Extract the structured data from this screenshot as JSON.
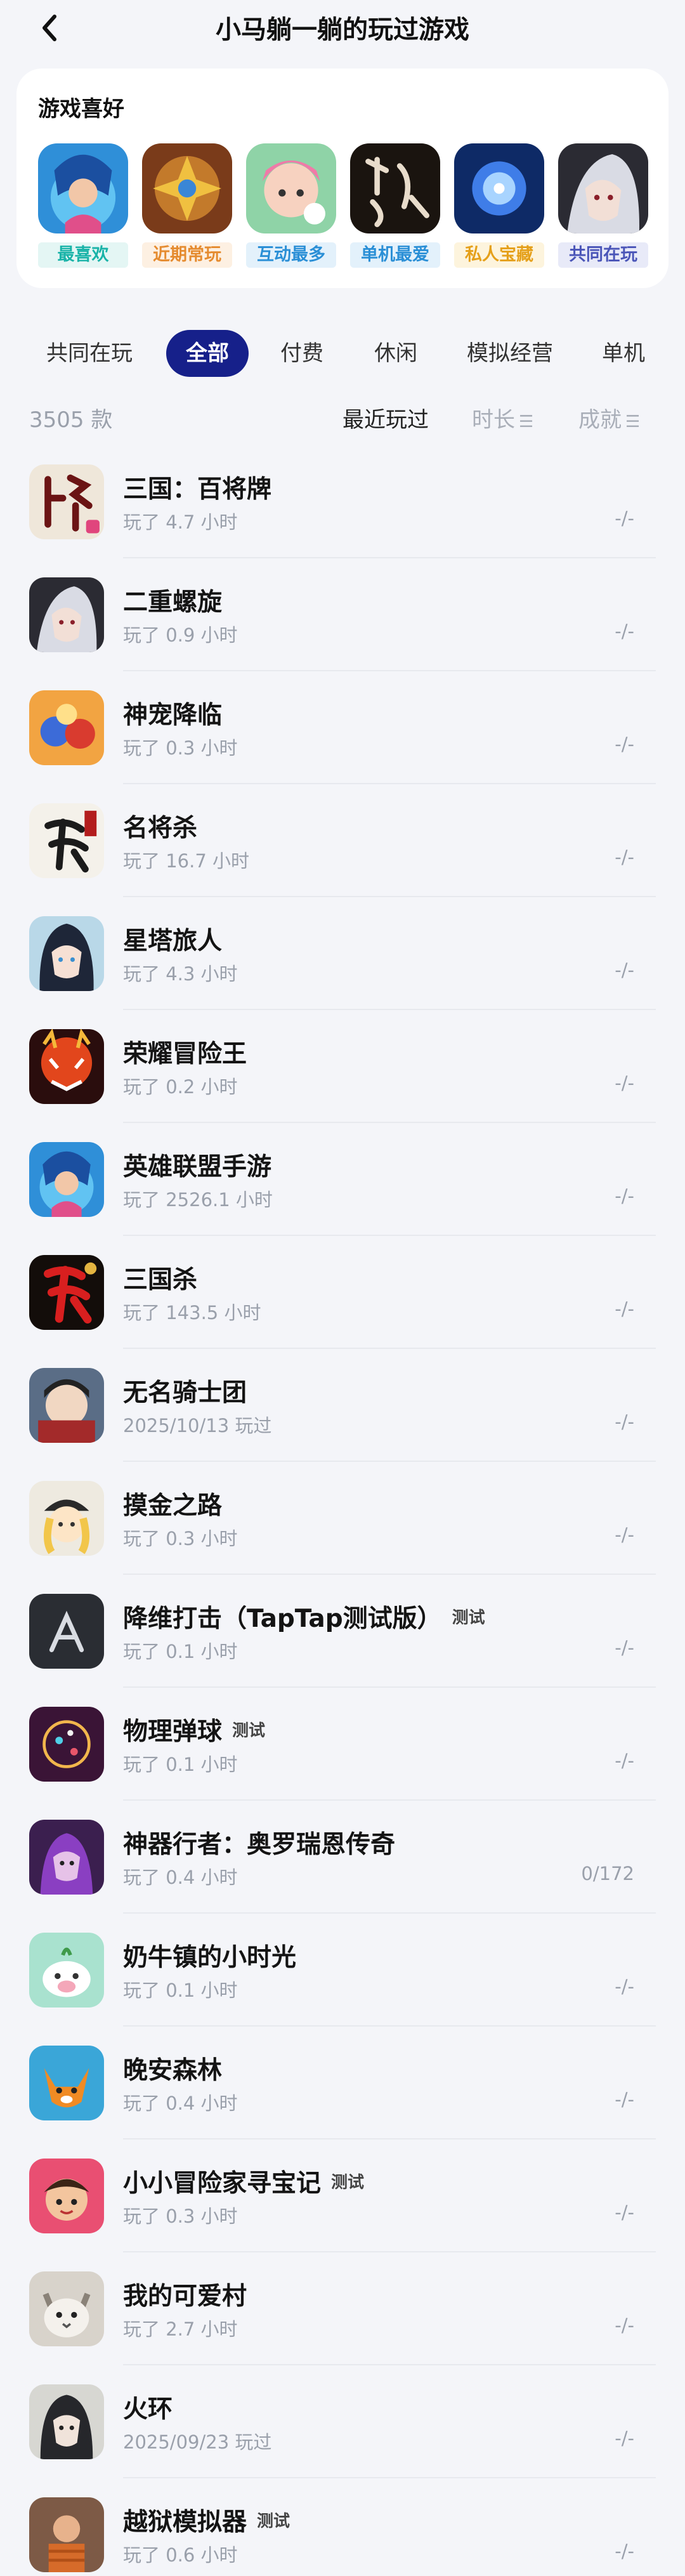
{
  "header": {
    "title": "小马躺一躺的玩过游戏"
  },
  "favorites": {
    "title": "游戏喜好",
    "items": [
      {
        "label": "最喜欢",
        "color": "#19b3a8",
        "bg": "#e4f6f4",
        "icon": "hero-lol-icon"
      },
      {
        "label": "近期常玩",
        "color": "#e58b2f",
        "bg": "#fdf0e2",
        "icon": "hearthstone-icon"
      },
      {
        "label": "互动最多",
        "color": "#2a8fd6",
        "bg": "#e3f1fb",
        "icon": "cute-girl-icon"
      },
      {
        "label": "单机最爱",
        "color": "#2a8fd6",
        "bg": "#e3f1fb",
        "icon": "jianghu-calligraphy-icon"
      },
      {
        "label": "私人宝藏",
        "color": "#e5a01a",
        "bg": "#fdf4dd",
        "icon": "crystal-ball-icon"
      },
      {
        "label": "共同在玩",
        "color": "#4a55b8",
        "bg": "#e8eaf8",
        "icon": "silver-hair-character-icon"
      }
    ]
  },
  "tabs": [
    {
      "label": "共同在玩",
      "active": false
    },
    {
      "label": "全部",
      "active": true
    },
    {
      "label": "付费",
      "active": false
    },
    {
      "label": "休闲",
      "active": false
    },
    {
      "label": "模拟经营",
      "active": false
    },
    {
      "label": "单机",
      "active": false
    }
  ],
  "sort": {
    "count": "3505 款",
    "options": [
      {
        "label": "最近玩过",
        "active": true
      },
      {
        "label": "时长",
        "active": false
      },
      {
        "label": "成就",
        "active": false
      }
    ]
  },
  "games": [
    {
      "name": "三国：百将牌",
      "sub": "玩了 4.7 小时",
      "ach": "-/-",
      "badge": "",
      "icon": "pai-card-icon"
    },
    {
      "name": "二重螺旋",
      "sub": "玩了 0.9 小时",
      "ach": "-/-",
      "badge": "",
      "icon": "silver-hair-character-icon"
    },
    {
      "name": "神宠降临",
      "sub": "玩了 0.3 小时",
      "ach": "-/-",
      "badge": "",
      "icon": "pet-squad-icon"
    },
    {
      "name": "名将杀",
      "sub": "玩了 16.7 小时",
      "ach": "-/-",
      "badge": "",
      "icon": "sha-calligraphy-icon"
    },
    {
      "name": "星塔旅人",
      "sub": "玩了 4.3 小时",
      "ach": "-/-",
      "badge": "",
      "icon": "anime-girl-icon"
    },
    {
      "name": "荣耀冒险王",
      "sub": "玩了 0.2 小时",
      "ach": "-/-",
      "badge": "",
      "icon": "demon-king-icon"
    },
    {
      "name": "英雄联盟手游",
      "sub": "玩了 2526.1 小时",
      "ach": "-/-",
      "badge": "",
      "icon": "hero-lol-icon"
    },
    {
      "name": "三国杀",
      "sub": "玩了 143.5 小时",
      "ach": "-/-",
      "badge": "",
      "icon": "sanguosha-icon"
    },
    {
      "name": "无名骑士团",
      "sub": "2025/10/13 玩过",
      "ach": "-/-",
      "badge": "",
      "icon": "knight-squad-icon"
    },
    {
      "name": "摸金之路",
      "sub": "玩了 0.3 小时",
      "ach": "-/-",
      "badge": "",
      "icon": "explorer-girl-icon"
    },
    {
      "name": "降维打击（TapTap测试版）",
      "sub": "玩了 0.1 小时",
      "ach": "-/-",
      "badge": "测试",
      "icon": "dark-logo-icon"
    },
    {
      "name": "物理弹球",
      "sub": "玩了 0.1 小时",
      "ach": "-/-",
      "badge": "测试",
      "icon": "pinball-icon"
    },
    {
      "name": "神器行者：奥罗瑞恩传奇",
      "sub": "玩了 0.4 小时",
      "ach": "0/172",
      "badge": "",
      "icon": "purple-hero-icon"
    },
    {
      "name": "奶牛镇的小时光",
      "sub": "玩了 0.1 小时",
      "ach": "-/-",
      "badge": "",
      "icon": "cow-farm-icon"
    },
    {
      "name": "晚安森林",
      "sub": "玩了 0.4 小时",
      "ach": "-/-",
      "badge": "",
      "icon": "fox-icon"
    },
    {
      "name": "小小冒险家寻宝记",
      "sub": "玩了 0.3 小时",
      "ach": "-/-",
      "badge": "测试",
      "icon": "adventurer-icon"
    },
    {
      "name": "我的可爱村",
      "sub": "玩了 2.7 小时",
      "ach": "-/-",
      "badge": "",
      "icon": "cat-icon"
    },
    {
      "name": "火环",
      "sub": "2025/09/23 玩过",
      "ach": "-/-",
      "badge": "",
      "icon": "dark-girl-icon"
    },
    {
      "name": "越狱模拟器",
      "sub": "玩了 0.6 小时",
      "ach": "-/-",
      "badge": "测试",
      "icon": "prisoner-icon"
    }
  ]
}
